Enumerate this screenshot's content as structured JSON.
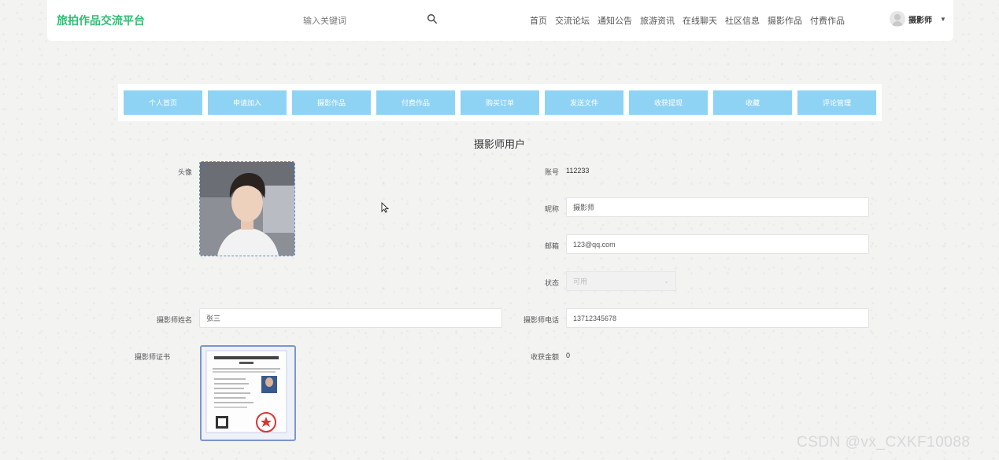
{
  "header": {
    "logo": "旅拍作品交流平台",
    "search_placeholder": "输入关键词",
    "nav": [
      "首页",
      "交流论坛",
      "通知公告",
      "旅游资讯",
      "在线聊天",
      "社区信息",
      "摄影作品",
      "付费作品"
    ],
    "user": "摄影师"
  },
  "tabs": [
    "个人首页",
    "申请加入",
    "摄影作品",
    "付费作品",
    "购买订单",
    "发送文件",
    "收获提现",
    "收藏",
    "评论管理"
  ],
  "page_title": "摄影师用户",
  "form": {
    "avatar_label": "头像",
    "account_label": "账号",
    "account_value": "112233",
    "nickname_label": "昵称",
    "nickname_value": "摄影师",
    "email_label": "邮箱",
    "email_value": "123@qq.com",
    "status_label": "状态",
    "status_value": "可用",
    "name_label": "摄影师姓名",
    "name_value": "张三",
    "phone_label": "摄影师电话",
    "phone_value": "13712345678",
    "cert_label": "摄影师证书",
    "income_label": "收获金额",
    "income_value": "0"
  },
  "watermark": "CSDN @vx_CXKF10088",
  "colors": {
    "accent": "#2dbd72",
    "tab_bg": "#8fd3f4",
    "border": "#e2e2e2"
  }
}
